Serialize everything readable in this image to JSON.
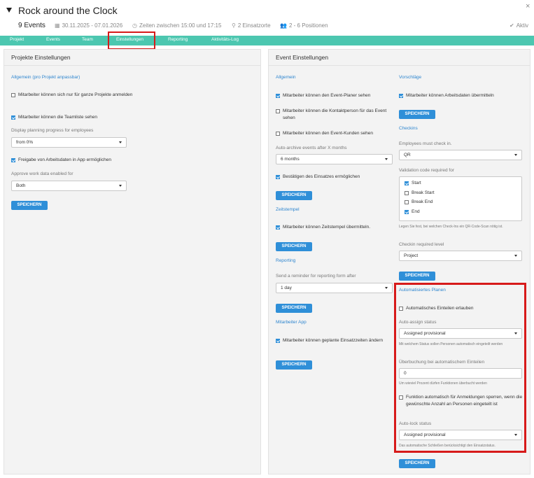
{
  "header": {
    "title": "Rock around the Clock",
    "close": "×",
    "event_count": "9 Events",
    "date_range": "30.11.2025 - 07.01.2026",
    "time_range": "Zeiten zwischen 15:00 und 17:15",
    "locations": "2 Einsatzorte",
    "positions": "2 - 6 Positionen",
    "status": "Aktiv"
  },
  "icons": {
    "collapse": "triangle-down-icon",
    "calendar": "calendar-icon",
    "clock": "clock-icon",
    "location": "location-pin-icon",
    "users": "users-icon",
    "check": "check-circle-icon",
    "close": "close-icon"
  },
  "tabs": [
    "Projekt",
    "Events",
    "Team",
    "Einstellungen",
    "Reporting",
    "Aktivitäts-Log"
  ],
  "active_tab": "Einstellungen",
  "colors": {
    "tabbar": "#4cc7b0",
    "accent": "#2f8fd8",
    "highlight": "#d71a1a"
  },
  "projekt": {
    "title": "Projekte Einstellungen",
    "section": "Allgemein (pro Projekt anpassbar)",
    "cb1": "Mitarbeiter können sich nur für ganze Projekte anmelden",
    "cb1_checked": false,
    "cb2": "Mitarbeiter können die Teamliste sehen",
    "cb2_checked": true,
    "progress_label": "Display planning progress for employees",
    "progress_value": "from 0%",
    "cb3": "Freigabe von Arbeitsdaten in App ermöglichen",
    "cb3_checked": true,
    "approve_label": "Approve work data enabled for",
    "approve_value": "Both",
    "save": "SPEICHERN"
  },
  "event": {
    "title": "Event Einstellungen",
    "allgemein": {
      "title": "Allgemein",
      "cb1": "Mitarbeiter können den Event-Planer sehen",
      "cb2": "Mitarbeiter können die Kontaktperson für das Event sehen",
      "cb3": "Mitarbeiter können den Event-Kunden sehen",
      "archive_label": "Auto-archive events after X months",
      "archive_value": "6 months",
      "cb4": "Bestätigen des Einsatzes ermöglichen",
      "save": "SPEICHERN"
    },
    "zeitstempel": {
      "title": "Zeitstempel",
      "cb1": "Mitarbeiter können Zeitstempel übermitteln.",
      "save": "SPEICHERN"
    },
    "reporting": {
      "title": "Reporting",
      "reminder_label": "Send a reminder for reporting form after",
      "reminder_value": "1 day",
      "save": "SPEICHERN"
    },
    "app": {
      "title": "Mitarbeiter App",
      "cb1": "Mitarbeiter können geplante Einsatzzeiten ändern",
      "save": "SPEICHERN"
    },
    "vorschlaege": {
      "title": "Vorschläge",
      "cb1": "Mitarbeiter können Arbeitsdaten übermitteln",
      "save": "SPEICHERN"
    },
    "checkins": {
      "title": "Checkins",
      "must_label": "Employees must check in.",
      "must_value": "QR",
      "code_label": "Validation code required for",
      "options": [
        "Start",
        "Break Start",
        "Break End",
        "End"
      ],
      "checked": [
        true,
        false,
        false,
        true
      ],
      "hint": "Legen Sie fest, bei welchen Check-Ins ein QR-Code-Scan nötig ist.",
      "level_label": "Checkin required level",
      "level_value": "Project",
      "save": "SPEICHERN"
    },
    "auto": {
      "title": "Automatisiertes Planen",
      "cb1": "Automatisches Einteilen erlauben",
      "status_label": "Auto-assign status",
      "status_value": "Assigned provisional",
      "status_hint": "Mit welchem Status sollen Personen automatisch eingeteilt werden",
      "over_label": "Überbuchung bei automatischem Einteilen",
      "over_value": "0",
      "over_hint": "Um wieviel Prozent dürfen Funktionen überbucht werden",
      "cb2": "Funktion automatisch für Anmeldungen sperren, wenn die gewünschte Anzahl an Personen eingeteilt ist",
      "lock_label": "Auto-lock status",
      "lock_value": "Assigned provisional",
      "lock_hint": "Das automatische Schließen berücksichtigt den Einsatzstatus.",
      "save": "SPEICHERN"
    }
  }
}
